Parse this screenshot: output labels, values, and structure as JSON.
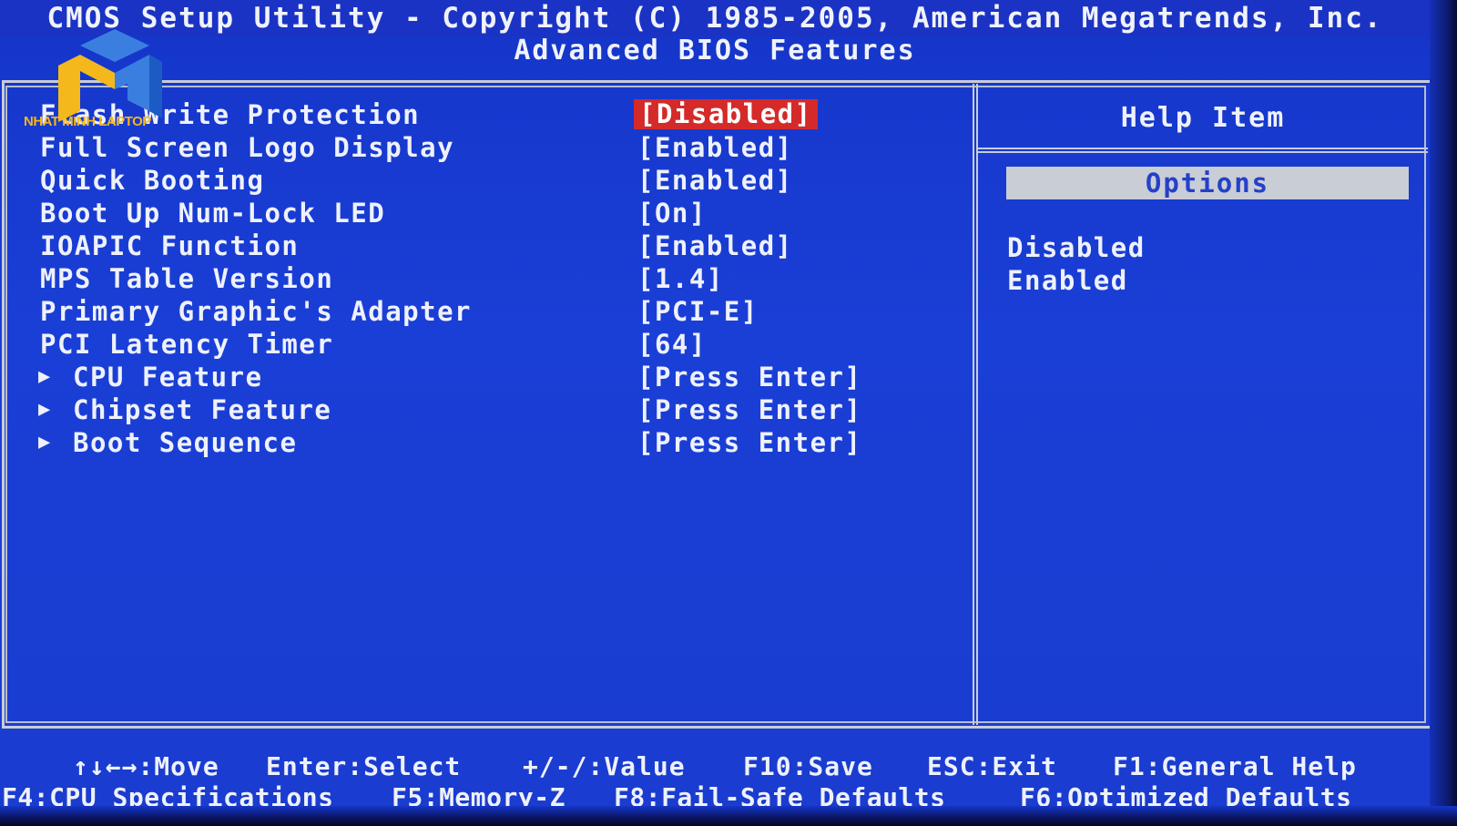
{
  "header": {
    "title": "CMOS Setup Utility - Copyright (C) 1985-2005, American Megatrends, Inc.",
    "subtitle": "Advanced BIOS Features"
  },
  "settings": [
    {
      "label": "Flash Write Protection",
      "value": "[Disabled]",
      "selected": true,
      "submenu": false
    },
    {
      "label": "Full Screen Logo Display",
      "value": "[Enabled]",
      "selected": false,
      "submenu": false
    },
    {
      "label": "Quick Booting",
      "value": "[Enabled]",
      "selected": false,
      "submenu": false
    },
    {
      "label": "Boot Up Num-Lock LED",
      "value": "[On]",
      "selected": false,
      "submenu": false
    },
    {
      "label": "IOAPIC Function",
      "value": "[Enabled]",
      "selected": false,
      "submenu": false
    },
    {
      "label": "MPS Table Version",
      "value": "[1.4]",
      "selected": false,
      "submenu": false
    },
    {
      "label": "Primary Graphic's Adapter",
      "value": "[PCI-E]",
      "selected": false,
      "submenu": false
    },
    {
      "label": "PCI Latency Timer",
      "value": "[64]",
      "selected": false,
      "submenu": false
    },
    {
      "label": "CPU Feature",
      "value": "[Press Enter]",
      "selected": false,
      "submenu": true
    },
    {
      "label": "Chipset Feature",
      "value": "[Press Enter]",
      "selected": false,
      "submenu": true
    },
    {
      "label": "Boot Sequence",
      "value": "[Press Enter]",
      "selected": false,
      "submenu": true
    }
  ],
  "help": {
    "title": "Help Item",
    "options_label": "Options",
    "options": [
      "Disabled",
      "Enabled"
    ]
  },
  "footer": {
    "move": "↑↓←→:Move",
    "select": "Enter:Select",
    "value": "+/-/:Value",
    "save": "F10:Save",
    "exit": "ESC:Exit",
    "help": "F1:General Help",
    "cpu_spec": "F4:CPU Specifications",
    "memory": "F5:Memory-Z",
    "failsafe": "F8:Fail-Safe Defaults",
    "optimized": "F6:Optimized Defaults"
  },
  "watermark": {
    "text": "NHAT MINH LAPTOP"
  },
  "colors": {
    "background": "#1a3fd6",
    "highlight": "#d42a2a",
    "options_bar": "#c9cdd6",
    "text": "#eef1fb",
    "logo": "#f4b81c"
  }
}
